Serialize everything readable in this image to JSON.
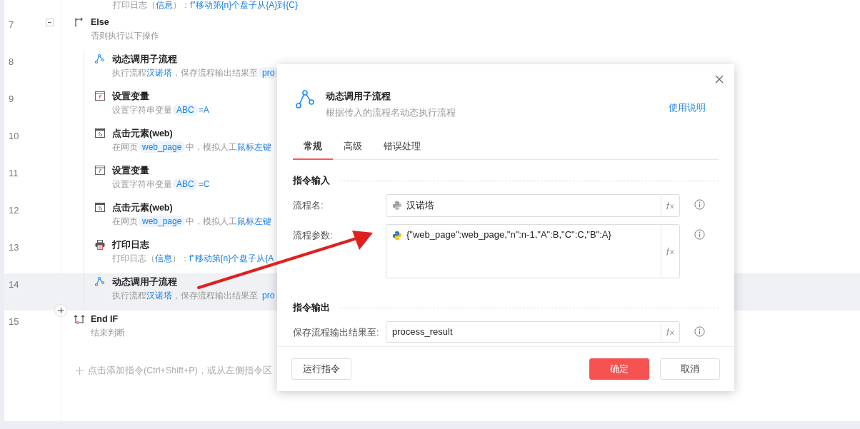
{
  "flow": {
    "partial_line": [
      {
        "kind": "plain",
        "text": "打印日志（"
      },
      {
        "kind": "link",
        "text": "信息"
      },
      {
        "kind": "plain",
        "text": "）："
      },
      {
        "kind": "link",
        "text": "f\"移动第{n}个盘子从{A}到{C}"
      }
    ],
    "rows": [
      {
        "number": "7",
        "kind": "else",
        "title": "Else",
        "selected": false,
        "expanded": true,
        "desc": [
          {
            "kind": "plain",
            "text": "否则执行以下操作"
          }
        ],
        "children": [
          {
            "number": "8",
            "kind": "subflow",
            "title": "动态调用子流程",
            "selected": false,
            "desc": [
              {
                "kind": "plain",
                "text": "执行流程"
              },
              {
                "kind": "link",
                "text": "汉诺塔"
              },
              {
                "kind": "plain",
                "text": "，保存流程输出结果至"
              },
              {
                "kind": "pill",
                "text": "pro"
              }
            ]
          },
          {
            "number": "9",
            "kind": "variable",
            "title": "设置变量",
            "selected": false,
            "desc": [
              {
                "kind": "plain",
                "text": "设置字符串变量"
              },
              {
                "kind": "pill",
                "text": "ABC"
              },
              {
                "kind": "link",
                "text": "=A"
              }
            ]
          },
          {
            "number": "10",
            "kind": "click",
            "title": "点击元素(web)",
            "selected": false,
            "desc": [
              {
                "kind": "plain",
                "text": "在网页"
              },
              {
                "kind": "pill",
                "text": "web_page"
              },
              {
                "kind": "plain",
                "text": "中，模拟人工"
              },
              {
                "kind": "link",
                "text": "鼠标左键"
              }
            ]
          },
          {
            "number": "11",
            "kind": "variable",
            "title": "设置变量",
            "selected": false,
            "desc": [
              {
                "kind": "plain",
                "text": "设置字符串变量"
              },
              {
                "kind": "pill",
                "text": "ABC"
              },
              {
                "kind": "link",
                "text": "=C"
              }
            ]
          },
          {
            "number": "12",
            "kind": "click",
            "title": "点击元素(web)",
            "selected": false,
            "desc": [
              {
                "kind": "plain",
                "text": "在网页"
              },
              {
                "kind": "pill",
                "text": "web_page"
              },
              {
                "kind": "plain",
                "text": "中，模拟人工"
              },
              {
                "kind": "link",
                "text": "鼠标左键"
              }
            ]
          },
          {
            "number": "13",
            "kind": "log",
            "title": "打印日志",
            "selected": false,
            "desc": [
              {
                "kind": "plain",
                "text": "打印日志（"
              },
              {
                "kind": "link",
                "text": "信息"
              },
              {
                "kind": "plain",
                "text": "）："
              },
              {
                "kind": "link",
                "text": "f\"移动第{n}个盘子从{A"
              }
            ]
          },
          {
            "number": "14",
            "kind": "subflow",
            "title": "动态调用子流程",
            "selected": true,
            "desc": [
              {
                "kind": "plain",
                "text": "执行流程"
              },
              {
                "kind": "link",
                "text": "汉诺塔"
              },
              {
                "kind": "plain",
                "text": "，保存流程输出结果至"
              },
              {
                "kind": "pill",
                "text": "pro"
              }
            ]
          }
        ]
      },
      {
        "number": "15",
        "kind": "endif",
        "title": "End IF",
        "selected": false,
        "desc": [
          {
            "kind": "plain",
            "text": "结束判断"
          }
        ]
      }
    ],
    "add_hint": "点击添加指令(Ctrl+Shift+P)，或从左侧指令区"
  },
  "dialog": {
    "title": "动态调用子流程",
    "subtitle": "根据传入的流程名动态执行流程",
    "help_link": "使用说明",
    "tabs": [
      {
        "label": "常规",
        "selected": true
      },
      {
        "label": "高级",
        "selected": false
      },
      {
        "label": "错误处理",
        "selected": false
      }
    ],
    "sections": [
      {
        "title": "指令输入",
        "fields": [
          {
            "kind": "expr",
            "label": "流程名:",
            "value": "汉诺塔"
          },
          {
            "kind": "python",
            "label": "流程参数:",
            "value": "{\"web_page\":web_page,\"n\":n-1,\"A\":B,\"C\":C,\"B\":A}"
          }
        ]
      },
      {
        "title": "指令输出",
        "fields": [
          {
            "kind": "text",
            "label": "保存流程输出结果至:",
            "value": "process_result"
          }
        ]
      }
    ],
    "buttons": [
      {
        "label": "运行指令",
        "kind": "default"
      },
      {
        "label": "确定",
        "kind": "primary"
      },
      {
        "label": "取消",
        "kind": "default"
      }
    ]
  }
}
